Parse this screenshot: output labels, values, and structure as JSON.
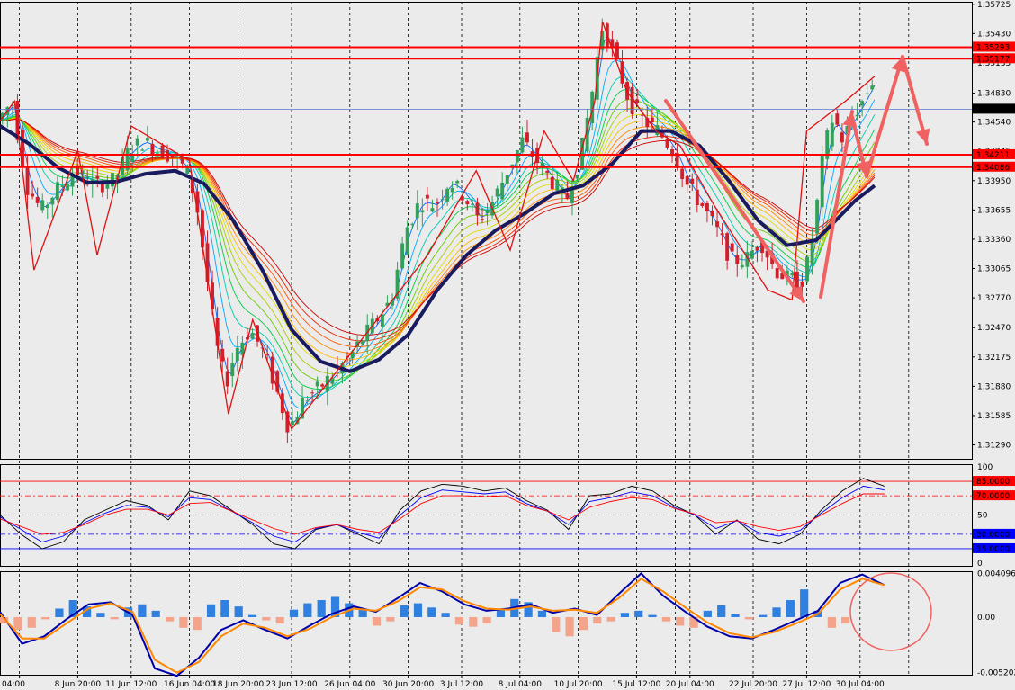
{
  "chart_data": [
    {
      "name": "main-price",
      "type": "candlestick",
      "instrument": "",
      "ylim": [
        1.3115,
        1.3575
      ],
      "y_ticks": [
        "1.35725",
        "1.35430",
        "1.35135",
        "1.34830",
        "1.34540",
        "1.34245",
        "1.33950",
        "1.33655",
        "1.33360",
        "1.33065",
        "1.32770",
        "1.32470",
        "1.32175",
        "1.31880",
        "1.31585",
        "1.31290"
      ],
      "x_ticks": [
        "04:00",
        "8 Jun 20:00",
        "11 Jun 12:00",
        "16 Jun 04:00",
        "18 Jun 20:00",
        "23 Jun 12:00",
        "26 Jun 04:00",
        "30 Jun 20:00",
        "3 Jul 12:00",
        "8 Jul 04:00",
        "10 Jul 20:00",
        "15 Jul 12:00",
        "20 Jul 04:00",
        "22 Jul 20:00",
        "27 Jul 12:00",
        "30 Jul 04:00"
      ],
      "x_tick_values": [
        0.02,
        0.08,
        0.135,
        0.195,
        0.245,
        0.3,
        0.36,
        0.42,
        0.475,
        0.535,
        0.595,
        0.655,
        0.71,
        0.775,
        0.83,
        0.885
      ],
      "horizontal_levels": [
        {
          "label": "1.35293",
          "value": 1.35293,
          "color": "#ff0000"
        },
        {
          "label": "1.35177",
          "value": 1.35177,
          "color": "#ff0000"
        },
        {
          "label": "1.34211",
          "value": 1.34211,
          "color": "#ff0000"
        },
        {
          "label": "1.34086",
          "value": 1.34086,
          "color": "#ff0000"
        }
      ],
      "current_price": {
        "label": "1.34669",
        "value": 1.34669
      },
      "price_path": [
        [
          0.0,
          1.3455
        ],
        [
          0.015,
          1.3475
        ],
        [
          0.03,
          1.339
        ],
        [
          0.045,
          1.3365
        ],
        [
          0.06,
          1.3385
        ],
        [
          0.08,
          1.3405
        ],
        [
          0.1,
          1.339
        ],
        [
          0.12,
          1.3395
        ],
        [
          0.135,
          1.3425
        ],
        [
          0.15,
          1.3435
        ],
        [
          0.165,
          1.3425
        ],
        [
          0.18,
          1.342
        ],
        [
          0.195,
          1.3405
        ],
        [
          0.205,
          1.337
        ],
        [
          0.215,
          1.33
        ],
        [
          0.225,
          1.323
        ],
        [
          0.235,
          1.319
        ],
        [
          0.245,
          1.3225
        ],
        [
          0.26,
          1.3245
        ],
        [
          0.275,
          1.322
        ],
        [
          0.29,
          1.3175
        ],
        [
          0.3,
          1.3145
        ],
        [
          0.315,
          1.3175
        ],
        [
          0.33,
          1.3185
        ],
        [
          0.345,
          1.32
        ],
        [
          0.36,
          1.3215
        ],
        [
          0.375,
          1.3235
        ],
        [
          0.39,
          1.3255
        ],
        [
          0.405,
          1.3275
        ],
        [
          0.42,
          1.3345
        ],
        [
          0.435,
          1.3375
        ],
        [
          0.45,
          1.337
        ],
        [
          0.465,
          1.3395
        ],
        [
          0.48,
          1.338
        ],
        [
          0.495,
          1.3355
        ],
        [
          0.51,
          1.3375
        ],
        [
          0.525,
          1.3405
        ],
        [
          0.54,
          1.3435
        ],
        [
          0.555,
          1.3415
        ],
        [
          0.57,
          1.3395
        ],
        [
          0.585,
          1.3375
        ],
        [
          0.6,
          1.342
        ],
        [
          0.612,
          1.3485
        ],
        [
          0.622,
          1.355
        ],
        [
          0.635,
          1.352
        ],
        [
          0.65,
          1.3475
        ],
        [
          0.665,
          1.3455
        ],
        [
          0.68,
          1.3445
        ],
        [
          0.695,
          1.3425
        ],
        [
          0.71,
          1.339
        ],
        [
          0.725,
          1.337
        ],
        [
          0.74,
          1.3345
        ],
        [
          0.755,
          1.3315
        ],
        [
          0.77,
          1.3315
        ],
        [
          0.785,
          1.3335
        ],
        [
          0.8,
          1.3305
        ],
        [
          0.815,
          1.3295
        ],
        [
          0.83,
          1.3295
        ],
        [
          0.84,
          1.3345
        ],
        [
          0.85,
          1.3425
        ],
        [
          0.86,
          1.346
        ],
        [
          0.87,
          1.3435
        ],
        [
          0.88,
          1.346
        ],
        [
          0.89,
          1.3475
        ],
        [
          0.9,
          1.3495
        ]
      ],
      "ma_path": [
        [
          0.0,
          1.345
        ],
        [
          0.03,
          1.3432
        ],
        [
          0.06,
          1.3408
        ],
        [
          0.09,
          1.3393
        ],
        [
          0.12,
          1.3394
        ],
        [
          0.15,
          1.3402
        ],
        [
          0.18,
          1.3405
        ],
        [
          0.21,
          1.3392
        ],
        [
          0.24,
          1.3355
        ],
        [
          0.27,
          1.3305
        ],
        [
          0.3,
          1.3245
        ],
        [
          0.33,
          1.3213
        ],
        [
          0.36,
          1.3203
        ],
        [
          0.39,
          1.3215
        ],
        [
          0.42,
          1.324
        ],
        [
          0.45,
          1.3285
        ],
        [
          0.48,
          1.332
        ],
        [
          0.51,
          1.3345
        ],
        [
          0.54,
          1.3362
        ],
        [
          0.57,
          1.3382
        ],
        [
          0.6,
          1.339
        ],
        [
          0.63,
          1.3412
        ],
        [
          0.66,
          1.3445
        ],
        [
          0.69,
          1.3445
        ],
        [
          0.72,
          1.343
        ],
        [
          0.75,
          1.3395
        ],
        [
          0.78,
          1.3355
        ],
        [
          0.81,
          1.333
        ],
        [
          0.84,
          1.3335
        ],
        [
          0.86,
          1.3355
        ],
        [
          0.88,
          1.3375
        ],
        [
          0.9,
          1.339
        ]
      ]
    },
    {
      "name": "oscillator-1",
      "type": "line",
      "ylim": [
        0,
        100
      ],
      "y_ticks": [
        "100",
        "50",
        "0"
      ],
      "levels": [
        {
          "label": "85.0000",
          "value": 85,
          "color": "#ff0000"
        },
        {
          "label": "70.0000",
          "value": 70,
          "color": "#ff0000"
        },
        {
          "label": "30.0000",
          "value": 30,
          "color": "#0000ff"
        },
        {
          "label": "15.0000",
          "value": 15,
          "color": "#0000ff"
        }
      ],
      "series": [
        {
          "color": "#000000",
          "values": [
            50,
            30,
            15,
            22,
            45,
            55,
            65,
            60,
            45,
            75,
            70,
            55,
            40,
            20,
            15,
            35,
            40,
            30,
            20,
            55,
            75,
            82,
            80,
            75,
            78,
            65,
            55,
            35,
            70,
            72,
            80,
            75,
            60,
            50,
            30,
            45,
            25,
            20,
            30,
            55,
            75,
            88,
            80
          ]
        },
        {
          "color": "#0000ff",
          "values": [
            48,
            35,
            22,
            28,
            42,
            52,
            60,
            58,
            48,
            68,
            66,
            54,
            42,
            28,
            22,
            36,
            40,
            32,
            26,
            50,
            68,
            76,
            74,
            72,
            74,
            62,
            54,
            40,
            64,
            68,
            74,
            70,
            58,
            50,
            36,
            44,
            32,
            28,
            34,
            52,
            68,
            80,
            76
          ]
        },
        {
          "color": "#ff0000",
          "values": [
            46,
            38,
            30,
            32,
            40,
            50,
            56,
            56,
            50,
            62,
            63,
            54,
            45,
            36,
            30,
            37,
            40,
            35,
            32,
            46,
            62,
            70,
            70,
            69,
            70,
            60,
            54,
            45,
            58,
            64,
            68,
            66,
            57,
            51,
            42,
            44,
            38,
            34,
            38,
            50,
            62,
            72,
            72
          ]
        }
      ]
    },
    {
      "name": "oscillator-2",
      "type": "bar-line",
      "ylim": [
        -0.0054,
        0.0043
      ],
      "y_ticks": [
        "0.0040965",
        "0.00",
        "-0.005202"
      ],
      "y_tick_values": [
        0.0040965,
        0.0,
        -0.005202
      ],
      "histogram": [
        -0.0006,
        -0.0012,
        -0.001,
        -0.0002,
        0.0008,
        0.0016,
        0.001,
        0.0004,
        -0.0002,
        0.0009,
        0.0012,
        0.0006,
        -0.0004,
        -0.001,
        -0.0012,
        0.0012,
        0.0016,
        0.001,
        0.0002,
        -0.0003,
        -0.0006,
        0.0007,
        0.0013,
        0.0016,
        0.0019,
        0.0013,
        0.0007,
        -0.0008,
        -0.0004,
        0.0011,
        0.0013,
        0.0009,
        0.0004,
        -0.0007,
        -0.0009,
        -0.0006,
        0.0007,
        0.0017,
        0.0014,
        0.0006,
        -0.0014,
        -0.0018,
        -0.0012,
        -0.0006,
        -0.0004,
        0.0004,
        0.0006,
        0.0002,
        -0.0004,
        -0.0008,
        -0.001,
        0.0006,
        0.0011,
        0.0003,
        -0.0002,
        0.0002,
        0.0009,
        0.0016,
        0.0026,
        0.0006,
        -0.001,
        -0.0006
      ],
      "series": [
        {
          "color": "#0000aa",
          "values": [
            0.0005,
            -0.0025,
            -0.0018,
            -0.0002,
            0.0012,
            0.0014,
            0.0002,
            -0.0048,
            -0.0055,
            -0.0038,
            -0.0012,
            -0.0003,
            -0.0012,
            -0.002,
            -0.0008,
            0.0003,
            0.001,
            0.0005,
            0.0018,
            0.0032,
            0.0024,
            0.0012,
            0.0006,
            0.0008,
            0.0012,
            0.0004,
            0.0008,
            0.0002,
            0.0022,
            0.0041,
            0.002,
            0.0005,
            -0.0009,
            -0.0018,
            -0.002,
            -0.0012,
            -0.0003,
            0.0006,
            0.0032,
            0.004,
            0.003
          ]
        },
        {
          "color": "#ff8800",
          "values": [
            0.0003,
            -0.002,
            -0.002,
            -0.0006,
            0.0008,
            0.0013,
            0.0005,
            -0.004,
            -0.0052,
            -0.0042,
            -0.0018,
            -0.0006,
            -0.001,
            -0.0018,
            -0.0011,
            0.0,
            0.0008,
            0.0006,
            0.0015,
            0.0028,
            0.0026,
            0.0015,
            0.0008,
            0.0007,
            0.001,
            0.0006,
            0.0007,
            0.0004,
            0.0018,
            0.0036,
            0.0024,
            0.0009,
            -0.0005,
            -0.0015,
            -0.0019,
            -0.0014,
            -0.0006,
            0.0003,
            0.0026,
            0.0036,
            0.003
          ]
        }
      ]
    }
  ]
}
